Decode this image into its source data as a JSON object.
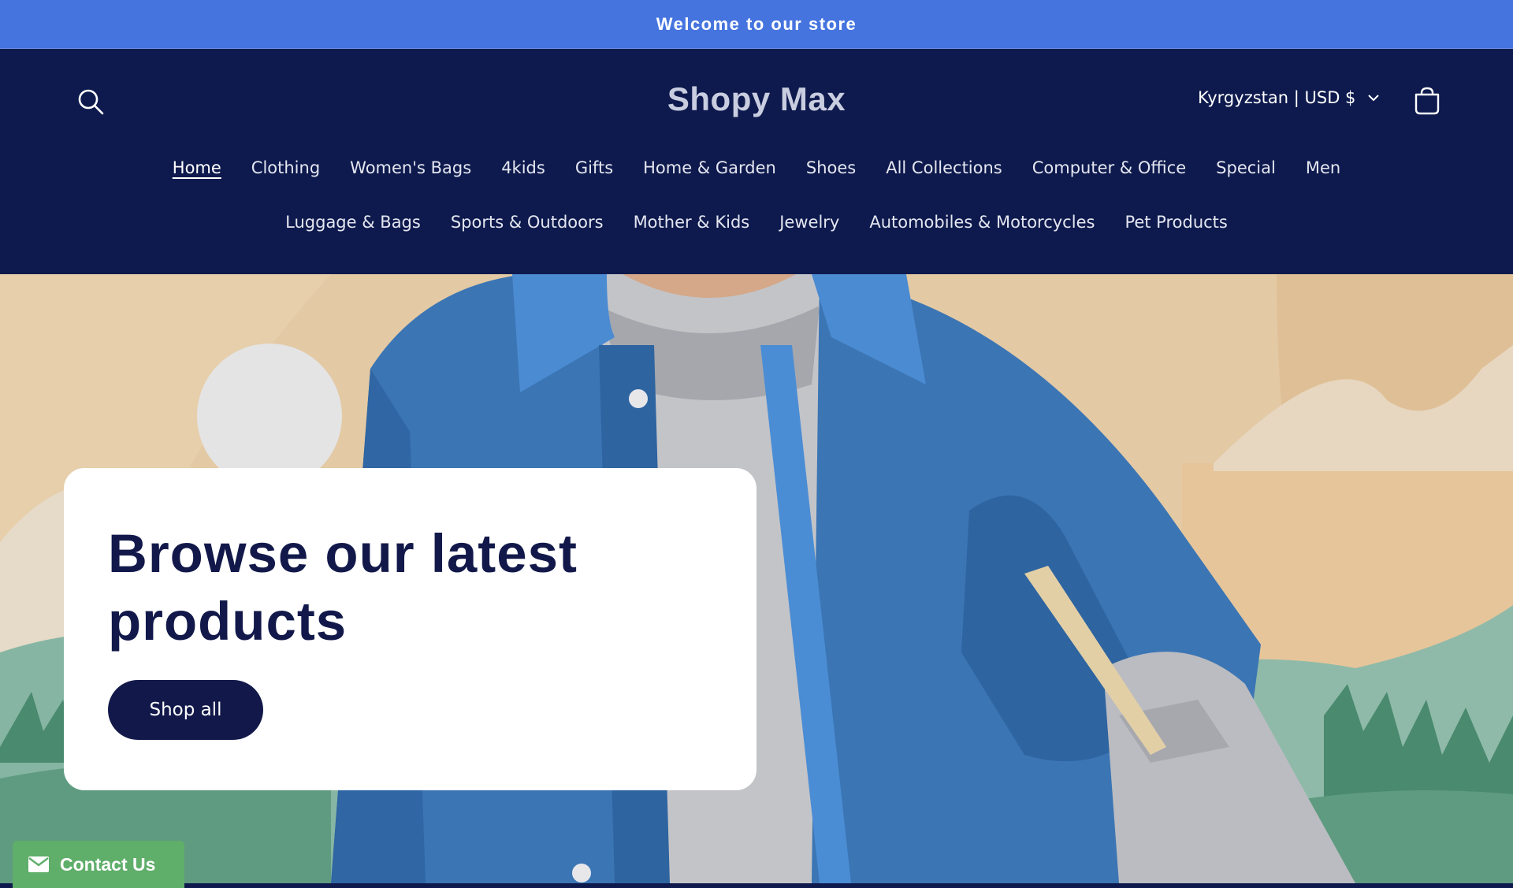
{
  "announcement": {
    "text": "Welcome to our store"
  },
  "header": {
    "logo": "Shopy Max",
    "country_selector": "Kyrgyzstan | USD $",
    "nav_row_1": [
      "Home",
      "Clothing",
      "Women's Bags",
      "4kids",
      "Gifts",
      "Home & Garden",
      "Shoes",
      "All Collections",
      "Computer & Office",
      "Special",
      "Men"
    ],
    "nav_row_2": [
      "Luggage & Bags",
      "Sports & Outdoors",
      "Mother & Kids",
      "Jewelry",
      "Automobiles & Motorcycles",
      "Pet Products"
    ],
    "active_nav": "Home"
  },
  "hero": {
    "title": "Browse our latest products",
    "button_label": "Shop all"
  },
  "contact": {
    "label": "Contact Us"
  },
  "icons": {
    "search": "search-icon",
    "chevron": "chevron-down-icon",
    "cart": "cart-icon",
    "mail": "mail-icon"
  },
  "colors": {
    "announcement_bg": "#4574df",
    "header_bg": "#0e1a4d",
    "button_bg": "#12194a",
    "contact_bg": "#5fae6a"
  }
}
